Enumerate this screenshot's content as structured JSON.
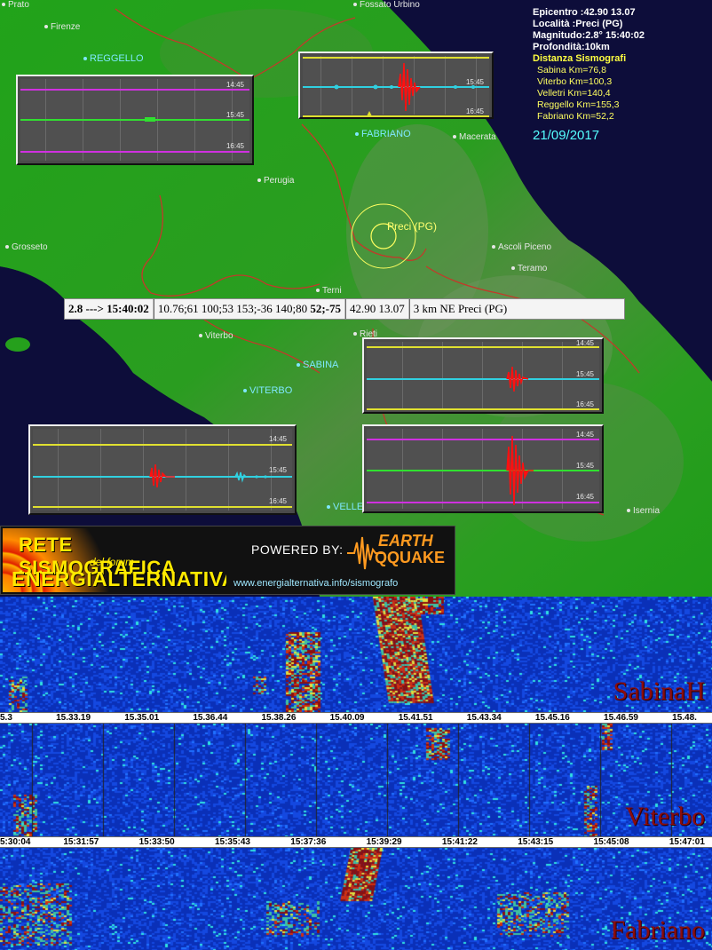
{
  "map": {
    "towns": [
      {
        "name": "Prato",
        "cyan": false
      },
      {
        "name": "Firenze",
        "cyan": false
      },
      {
        "name": "REGGELLO",
        "cyan": true
      },
      {
        "name": "Fossato Urbino",
        "cyan": false
      },
      {
        "name": "FABRIANO",
        "cyan": true
      },
      {
        "name": "Macerata",
        "cyan": false
      },
      {
        "name": "Perugia",
        "cyan": false
      },
      {
        "name": "Grosseto",
        "cyan": false
      },
      {
        "name": "Ascoli Piceno",
        "cyan": false
      },
      {
        "name": "Teramo",
        "cyan": false
      },
      {
        "name": "Terni",
        "cyan": false
      },
      {
        "name": "Viterbo",
        "cyan": false
      },
      {
        "name": "Rieti",
        "cyan": false
      },
      {
        "name": "SABINA",
        "cyan": true
      },
      {
        "name": "VITERBO",
        "cyan": true
      },
      {
        "name": "VELLETRI",
        "cyan": true
      },
      {
        "name": "Isernia",
        "cyan": false
      }
    ],
    "epicenter_label": "Preci (PG)"
  },
  "info": {
    "epicentro": "Epicentro :42.90 13.07",
    "localita": "Località :Preci (PG)",
    "magnitudo": "Magnitudo:2.8° 15:40:02",
    "profondita": "Profondità:10km",
    "distanza_title": "Distanza Sismografi",
    "distances": [
      "Sabina Km=76,8",
      "Viterbo Km=100,3",
      "Velletri Km=140,4",
      "Reggello Km=155,3",
      "Fabriano Km=52,2"
    ],
    "date": "21/09/2017"
  },
  "event_bar": {
    "mag_time": "2.8 ---> 15:40:02",
    "values": "10.76;61 100;53 153;-36 140;80",
    "values_bold": "52;-75",
    "coords": "42.90 13.07",
    "place": "3 km NE Preci (PG)"
  },
  "panels": {
    "time_labels": [
      "14:45",
      "15:45",
      "16:45"
    ]
  },
  "banner": {
    "line1": "RETE SISMOGRAFICA",
    "line2": "del forum",
    "line3": "ENERGIALTERNATIVA",
    "powered": "POWERED BY:",
    "logo_top": "EARTH",
    "logo_bottom": "QQUAKE",
    "url": "www.energialternativa.info/sismografo"
  },
  "spectrograms": [
    {
      "station": "SabinaH",
      "ticks": [
        "5.3",
        "15.33.19",
        "15.35.01",
        "15.36.44",
        "15.38.26",
        "15.40.09",
        "15.41.51",
        "15.43.34",
        "15.45.16",
        "15.46.59",
        "15.48."
      ]
    },
    {
      "station": "Viterbo",
      "ticks": [
        "5:30:04",
        "15:31:57",
        "15:33:50",
        "15:35:43",
        "15:37:36",
        "15:39:29",
        "15:41:22",
        "15:43:15",
        "15:45:08",
        "15:47:01"
      ]
    },
    {
      "station": "Fabriano",
      "ticks": []
    }
  ],
  "colors": {
    "trace_magenta": "#d030e0",
    "trace_green": "#30e030",
    "trace_cyan": "#30d0e0",
    "trace_yellow": "#e0e030",
    "event_red": "#ff1010"
  }
}
